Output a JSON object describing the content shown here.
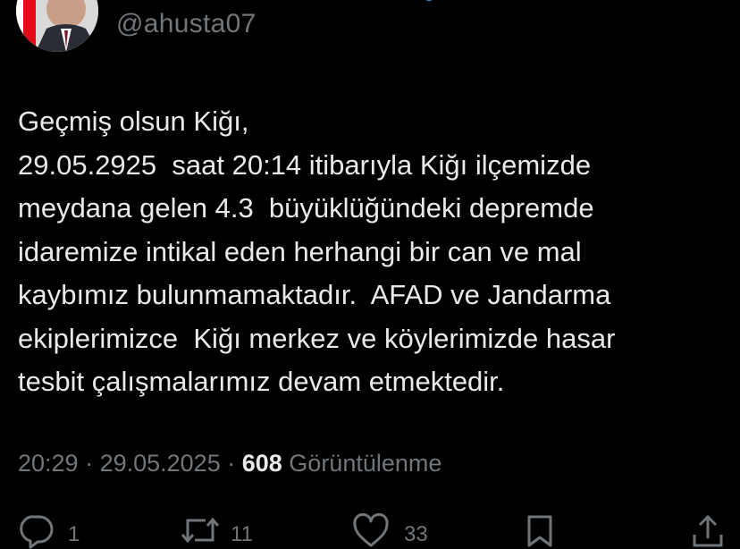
{
  "colors": {
    "background": "#000000",
    "text": "#e7e9ea",
    "muted": "#71767b",
    "flag_red": "#e30a17"
  },
  "user": {
    "handle": "@ahusta07",
    "avatar_icon": "profile-photo"
  },
  "tweet": {
    "lines": [
      "Geçmiş olsun Kiğı,",
      "29.05.2925  saat 20:14 itibarıyla Kiğı ilçemizde",
      "meydana gelen 4.3  büyüklüğündeki depremde",
      "idaremize intikal eden herhangi bir can ve mal",
      "kaybımız bulunmamaktadır.  AFAD ve Jandarma",
      "ekiplerimizce  Kiğı merkez ve köylerimizde hasar",
      "tesbit çalışmalarımız devam etmektedir."
    ]
  },
  "meta": {
    "time": "20:29",
    "separator": " · ",
    "date": "29.05.2025",
    "views_count": "608",
    "views_label": "Görüntülenme"
  },
  "actions": {
    "reply": {
      "icon": "reply-icon",
      "count": "1"
    },
    "retweet": {
      "icon": "retweet-icon",
      "count": "11"
    },
    "like": {
      "icon": "heart-icon",
      "count": "33"
    },
    "bookmark": {
      "icon": "bookmark-icon"
    },
    "share": {
      "icon": "share-icon"
    }
  }
}
